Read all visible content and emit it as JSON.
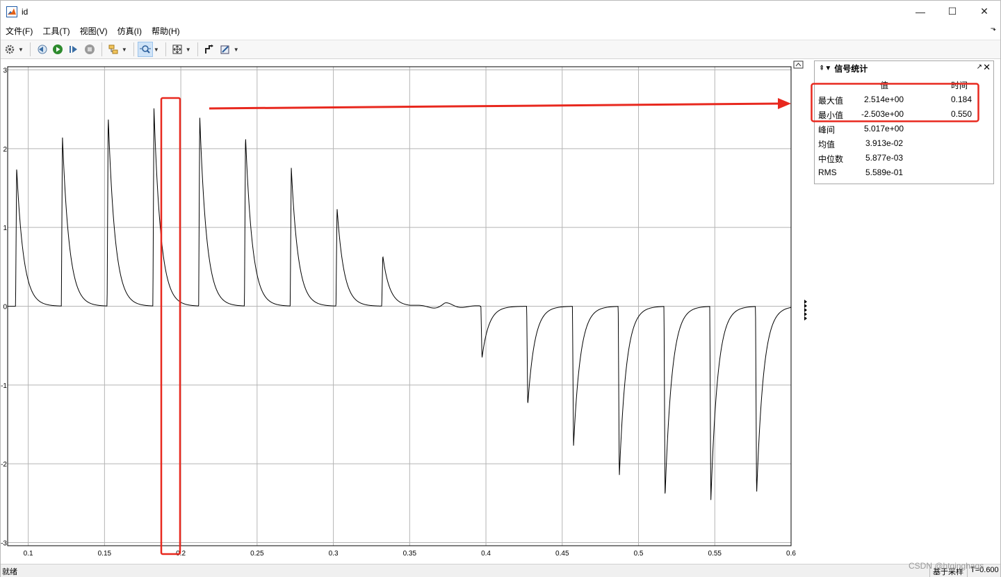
{
  "window": {
    "title": "id",
    "controls": {
      "minimize": "—",
      "maximize": "☐",
      "close": "✕"
    }
  },
  "menu": {
    "items": [
      "文件(F)",
      "工具(T)",
      "视图(V)",
      "仿真(I)",
      "帮助(H)"
    ]
  },
  "toolbar": {
    "buttons": [
      "settings-icon",
      "step-back-icon",
      "run-icon",
      "step-forward-icon",
      "stop-icon",
      "signal-icon",
      "zoom-icon",
      "fit-icon",
      "cursor-icon",
      "style-icon"
    ]
  },
  "stats": {
    "title": "信号统计",
    "col_value": "值",
    "col_time": "时间",
    "rows": [
      {
        "label": "最大值",
        "value": "2.514e+00",
        "time": "0.184"
      },
      {
        "label": "最小值",
        "value": "-2.503e+00",
        "time": "0.550"
      },
      {
        "label": "峰间",
        "value": "5.017e+00",
        "time": ""
      },
      {
        "label": "均值",
        "value": "3.913e-02",
        "time": ""
      },
      {
        "label": "中位数",
        "value": "5.877e-03",
        "time": ""
      },
      {
        "label": "RMS",
        "value": "5.589e-01",
        "time": ""
      }
    ]
  },
  "status": {
    "left": "就绪",
    "sample": "基于采样",
    "time": "T=0.600"
  },
  "watermark": "CSDN @htqinghaqs",
  "colors": {
    "highlight": "#e8281e",
    "trace": "#000000",
    "grid": "#b4b4b4"
  },
  "chart_data": {
    "type": "line",
    "x_ticks": [
      0.1,
      0.15,
      0.2,
      0.25,
      0.3,
      0.35,
      0.4,
      0.45,
      0.5,
      0.55,
      0.6
    ],
    "y_ticks": [
      3,
      2,
      1,
      0,
      -1,
      -2,
      -3
    ],
    "xlim": [
      0.0865,
      0.6
    ],
    "ylim": [
      -3.04,
      3.04
    ],
    "grid": true,
    "series": [
      {
        "pulses": [
          {
            "t": 0.0917,
            "peak": 1.76
          },
          {
            "t": 0.1217,
            "peak": 2.16
          },
          {
            "t": 0.1517,
            "peak": 2.42
          },
          {
            "t": 0.1817,
            "peak": 2.51
          },
          {
            "t": 0.2117,
            "peak": 2.42
          },
          {
            "t": 0.2417,
            "peak": 2.17
          },
          {
            "t": 0.2717,
            "peak": 1.76
          },
          {
            "t": 0.3017,
            "peak": 1.25
          },
          {
            "t": 0.3317,
            "peak": 0.64
          },
          {
            "t": 0.3967,
            "peak": -0.66
          },
          {
            "t": 0.4267,
            "peak": -1.26
          },
          {
            "t": 0.4567,
            "peak": -1.78
          },
          {
            "t": 0.4867,
            "peak": -2.18
          },
          {
            "t": 0.5167,
            "peak": -2.42
          },
          {
            "t": 0.5467,
            "peak": -2.48
          },
          {
            "t": 0.5767,
            "peak": -2.4
          }
        ]
      }
    ]
  }
}
